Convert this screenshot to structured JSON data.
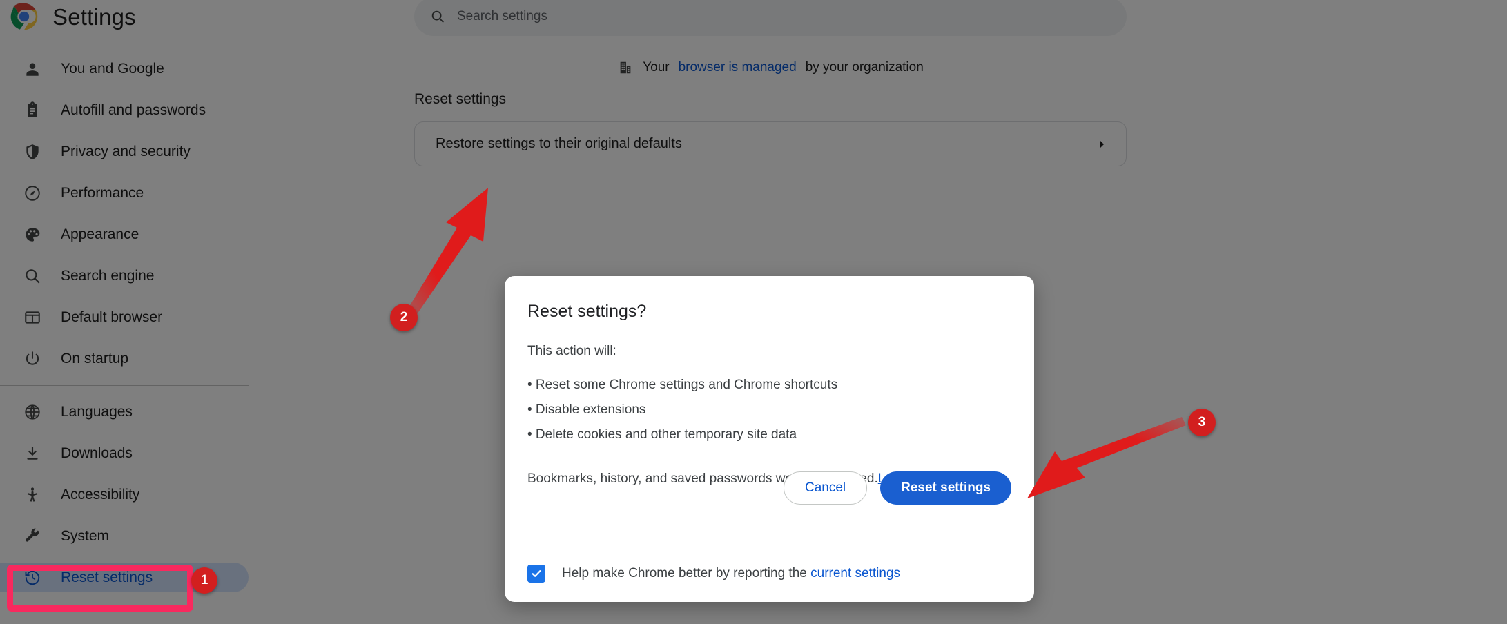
{
  "app": {
    "logo_icon": "chrome-logo-icon",
    "title": "Settings"
  },
  "sidebar": {
    "items": [
      {
        "label": "You and Google",
        "icon": "person-icon",
        "selected": false
      },
      {
        "label": "Autofill and passwords",
        "icon": "clipboard-icon",
        "selected": false
      },
      {
        "label": "Privacy and security",
        "icon": "shield-icon",
        "selected": false
      },
      {
        "label": "Performance",
        "icon": "speedometer-icon",
        "selected": false
      },
      {
        "label": "Appearance",
        "icon": "palette-icon",
        "selected": false
      },
      {
        "label": "Search engine",
        "icon": "search-icon",
        "selected": false
      },
      {
        "label": "Default browser",
        "icon": "browser-window-icon",
        "selected": false
      },
      {
        "label": "On startup",
        "icon": "power-icon",
        "selected": false
      },
      {
        "label": "Languages",
        "icon": "globe-icon",
        "selected": false
      },
      {
        "label": "Downloads",
        "icon": "download-icon",
        "selected": false
      },
      {
        "label": "Accessibility",
        "icon": "accessibility-icon",
        "selected": false
      },
      {
        "label": "System",
        "icon": "wrench-icon",
        "selected": false
      },
      {
        "label": "Reset settings",
        "icon": "history-restore-icon",
        "selected": true
      }
    ]
  },
  "search": {
    "placeholder": "Search settings",
    "value": "",
    "icon": "search-icon"
  },
  "managed_banner": {
    "icon": "building-icon",
    "prefix": "Your ",
    "link": "browser is managed",
    "suffix": " by your organization"
  },
  "main": {
    "section_title": "Reset settings",
    "restore_row": {
      "label": "Restore settings to their original defaults",
      "chevron_icon": "chevron-right-icon"
    }
  },
  "dialog": {
    "title": "Reset settings?",
    "lead": "This action will:",
    "bullets": [
      "• Reset some Chrome settings and Chrome shortcuts",
      "• Disable extensions",
      "• Delete cookies and other temporary site data"
    ],
    "note_text": "Bookmarks, history, and saved passwords won't be affected.",
    "note_link": "Learn more",
    "cancel_label": "Cancel",
    "confirm_label": "Reset settings",
    "footer": {
      "checkbox_checked": true,
      "checkbox_icon": "check-icon",
      "text": "Help make Chrome better by reporting the ",
      "link": "current settings"
    }
  },
  "annotations": {
    "markers": [
      {
        "number": "1"
      },
      {
        "number": "2"
      },
      {
        "number": "3"
      }
    ],
    "highlight_color": "#f9295e",
    "marker_color": "#d21f1f",
    "arrow_color": "#e01b1b"
  },
  "colors": {
    "accent_blue": "#0b57d0",
    "button_blue": "#1a5fd0",
    "selected_pill": "#d3e3fd",
    "scrim": "rgba(0,0,0,0.50)"
  }
}
